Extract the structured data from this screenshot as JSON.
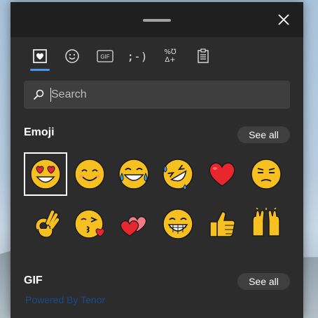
{
  "window": {
    "close_label": "Close"
  },
  "tabs": [
    {
      "name": "favorites",
      "icon": "heart-icon",
      "active": true
    },
    {
      "name": "emoji",
      "icon": "smiley-icon"
    },
    {
      "name": "gif",
      "icon": "gif-icon",
      "label": "GIF"
    },
    {
      "name": "kaomoji",
      "icon": "kaomoji-icon",
      "label": ";-)"
    },
    {
      "name": "symbols",
      "icon": "symbols-icon",
      "label_top": "%℧",
      "label_bottom": "Δ+"
    },
    {
      "name": "clipboard",
      "icon": "clipboard-icon"
    }
  ],
  "search": {
    "placeholder": "Search"
  },
  "sections": {
    "emoji": {
      "title": "Emoji",
      "see_all": "See all"
    },
    "gif": {
      "title": "GIF",
      "see_all": "See all",
      "powered_by": "Powered By Tenor"
    }
  },
  "emojis": [
    {
      "name": "heart-eyes-emoji",
      "selected": true
    },
    {
      "name": "smiling-emoji"
    },
    {
      "name": "tears-of-joy-emoji"
    },
    {
      "name": "rolling-laughing-emoji"
    },
    {
      "name": "red-heart-emoji"
    },
    {
      "name": "unamused-emoji"
    },
    {
      "name": "ok-hand-emoji"
    },
    {
      "name": "kissing-heart-emoji"
    },
    {
      "name": "two-hearts-emoji"
    },
    {
      "name": "grinning-teeth-emoji"
    },
    {
      "name": "thumbs-up-emoji"
    },
    {
      "name": "raising-hands-emoji"
    }
  ],
  "colors": {
    "panel": "#2c2c2c",
    "titlebar": "#1f1f1f",
    "accent": "#4d96e8",
    "emoji_yellow": "#f7c021",
    "heart_red": "#e8262d"
  }
}
